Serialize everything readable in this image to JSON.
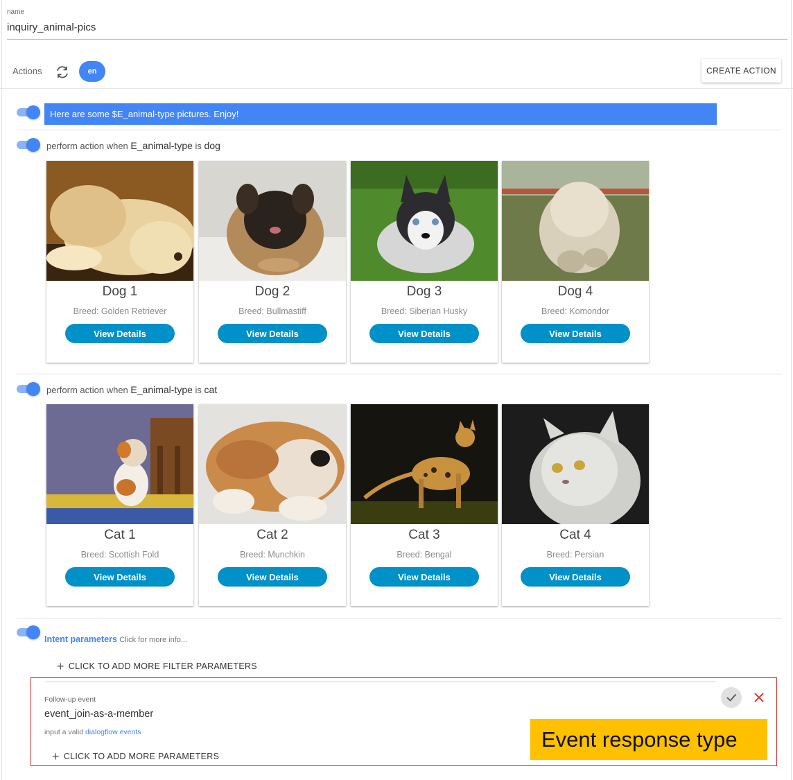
{
  "name_field": {
    "label": "name",
    "value": "inquiry_animal-pics"
  },
  "actions_bar": {
    "label": "Actions",
    "lang": "en",
    "create_label": "CREATE ACTION"
  },
  "text_response": "Here are some $E_animal-type pictures. Enjoy!",
  "dog_section": {
    "prefix": "perform action when",
    "entity": "E_animal-type",
    "is": "is",
    "value": "dog",
    "cards": [
      {
        "title": "Dog 1",
        "subtitle": "Breed: Golden Retriever",
        "button": "View Details"
      },
      {
        "title": "Dog 2",
        "subtitle": "Breed: Bullmastiff",
        "button": "View Details"
      },
      {
        "title": "Dog 3",
        "subtitle": "Breed: Siberian Husky",
        "button": "View Details"
      },
      {
        "title": "Dog 4",
        "subtitle": "Breed: Komondor",
        "button": "View Details"
      }
    ]
  },
  "cat_section": {
    "prefix": "perform action when",
    "entity": "E_animal-type",
    "is": "is",
    "value": "cat",
    "cards": [
      {
        "title": "Cat 1",
        "subtitle": "Breed: Scottish Fold",
        "button": "View Details"
      },
      {
        "title": "Cat 2",
        "subtitle": "Breed: Munchkin",
        "button": "View Details"
      },
      {
        "title": "Cat 3",
        "subtitle": "Breed: Bengal",
        "button": "View Details"
      },
      {
        "title": "Cat 4",
        "subtitle": "Breed: Persian",
        "button": "View Details"
      }
    ]
  },
  "intent_params": {
    "link": "Intent parameters",
    "hint": "Click for more info..."
  },
  "add_filter_label": "CLICK TO ADD MORE FILTER PARAMETERS",
  "followup": {
    "label": "Follow-up event",
    "value": "event_join-as-a-member",
    "hint_prefix": "input a valid",
    "hint_link": "dialogflow events",
    "add_params_label": "CLICK TO ADD MORE PARAMETERS"
  },
  "callout": "Event response type",
  "colors": {
    "accent": "#4285f4",
    "button": "#0091c9",
    "highlight": "#d32f2f",
    "callout": "#ffc000"
  }
}
